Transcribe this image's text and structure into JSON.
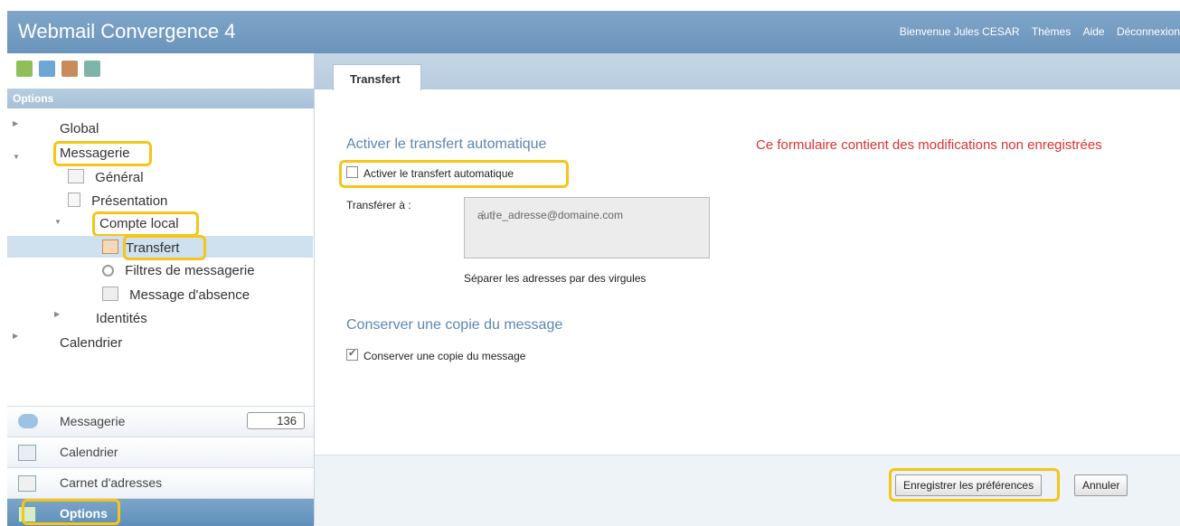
{
  "header": {
    "title": "Webmail Convergence 4",
    "welcome": "Bienvenue Jules CESAR",
    "themes": "Thèmes",
    "help": "Aide",
    "logout": "Déconnexion"
  },
  "toolbar": {
    "icons": [
      "new-folder-icon",
      "export-icon",
      "import-icon",
      "rename-icon"
    ]
  },
  "left": {
    "section_title": "Options",
    "tree": {
      "global": "Global",
      "messagerie": "Messagerie",
      "general": "Général",
      "presentation": "Présentation",
      "compte_local": "Compte local",
      "transfert": "Transfert",
      "filtres": "Filtres de messagerie",
      "absence": "Message d'absence",
      "identites": "Identités",
      "calendrier": "Calendrier"
    },
    "nav": {
      "messagerie": "Messagerie",
      "messagerie_count": "136",
      "calendrier": "Calendrier",
      "carnet": "Carnet d'adresses",
      "options": "Options"
    }
  },
  "main": {
    "tab": "Transfert",
    "section1_title": "Activer le transfert automatique",
    "auto_forward_label": "Activer le transfert automatique",
    "auto_forward_checked": false,
    "warning": "Ce formulaire contient des modifications non enregistrées",
    "forward_to_label": "Transférer à :",
    "forward_to_value": "autre_adresse@domaine.com",
    "hint": "Séparer les adresses par des virgules",
    "section2_title": "Conserver une copie du message",
    "keep_copy_label": "Conserver une copie du message",
    "keep_copy_checked": true,
    "save_button": "Enregistrer les préférences",
    "cancel_button": "Annuler"
  },
  "colors": {
    "header": "#6b94bc",
    "highlight": "#f5c518",
    "warning": "#dd3333",
    "section_title": "#5b86b3"
  }
}
